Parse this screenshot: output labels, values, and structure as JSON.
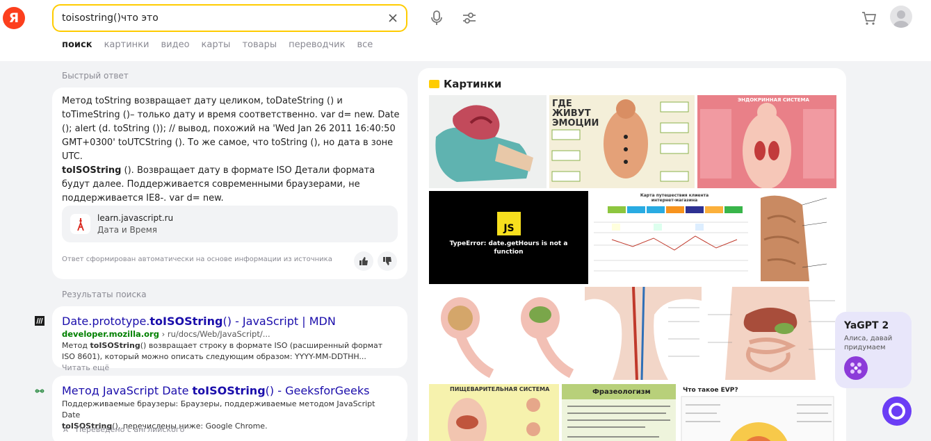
{
  "header": {
    "logo_text": "Я",
    "search_value": "toisostring()что это",
    "tabs": [
      "поиск",
      "картинки",
      "видео",
      "карты",
      "товары",
      "переводчик",
      "все"
    ]
  },
  "quick_answer": {
    "section_label": "Быстрый ответ",
    "text_1": "Метод toString возвращает дату целиком, toDateString () и toTimeString ()– только дату и время соответственно. var d= new. Date (); alert (d. toString ()); // вывод, похожий на 'Wed Jan 26 2011 16:40:50 GMT+0300' toUTCString (). То же самое, что toString (), но дата в зоне UTC.",
    "text_bold": "toISOString",
    "text_2": " (). Возвращает дату в формате ISO Детали формата будут далее. Поддерживается современными браузерами, не поддерживается IE8-. var d= new.",
    "source_domain": "learn.javascript.ru",
    "source_sub": "Дата и Время",
    "auto_note": "Ответ сформирован автоматически на основе информации из источника"
  },
  "results": {
    "section_label": "Результаты поиска",
    "items": [
      {
        "title_pre": "Date.prototype.",
        "title_bold": "toISOString",
        "title_post": "() - JavaScript | MDN",
        "domain": "developer.mozilla.org",
        "path": " › ru/docs/Web/JavaScript/...",
        "snip_pre": "Метод ",
        "snip_bold": "toISOString",
        "snip_post": "() возвращает строку в формате ISO (расширенный формат ISO 8601), который можно описать следующим образом: YYYY-MM-DDTHH...",
        "more": " Читать ещё"
      },
      {
        "title_pre": "Метод JavaScript Date ",
        "title_bold": "toISOString",
        "title_post": "() - GeeksforGeeks",
        "snip_1": "Поддерживаемые браузеры: Браузеры, поддерживаемые методом JavaScript Date",
        "snip_bold": "toISOString",
        "snip_2": "(), перечислены ниже: Google Chrome.",
        "translated": "Переведено с английского"
      }
    ]
  },
  "images": {
    "title": "Картинки",
    "labels": {
      "emotions": "ГДЕ ЖИВУТ ЭМОЦИИ",
      "endocrine": "ЭНДОКРИННАЯ СИСТЕМА",
      "js_badge": "JS",
      "js_error": "TypeError: date.getHours is not a function",
      "journey": "Карта путешествия клиента интернет-магазина",
      "digestive": "ПИЩЕВАРИТЕЛЬНАЯ СИСТЕМА",
      "phraseology": "Фразеологизм",
      "evp": "Что такое EVP?"
    }
  },
  "yagpt": {
    "title": "YaGPT 2",
    "subtitle": "Алиса, давай придумаем"
  }
}
